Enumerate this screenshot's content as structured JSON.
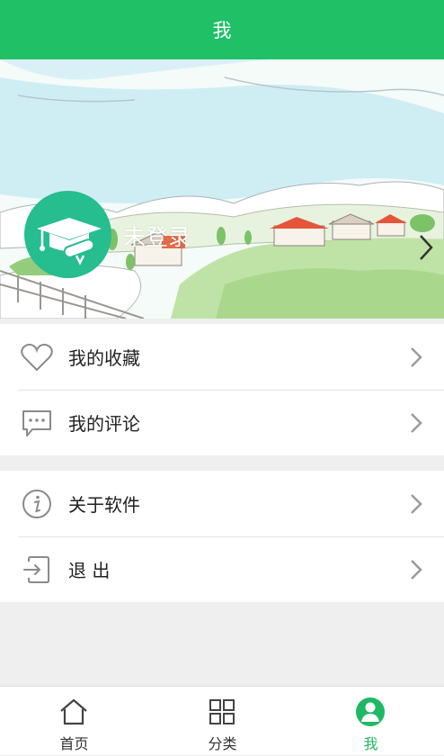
{
  "header": {
    "title": "我"
  },
  "profile": {
    "login_text": "未登录",
    "avatar_icon": "graduation-cap-icon"
  },
  "menu_group_1": [
    {
      "label": "我的收藏",
      "icon": "heart-icon"
    },
    {
      "label": "我的评论",
      "icon": "comment-icon"
    }
  ],
  "menu_group_2": [
    {
      "label": "关于软件",
      "icon": "info-icon"
    },
    {
      "label": "退 出",
      "icon": "logout-icon"
    }
  ],
  "tabs": [
    {
      "label": "首页",
      "icon": "home-icon"
    },
    {
      "label": "分类",
      "icon": "grid-icon"
    },
    {
      "label": "我",
      "icon": "user-icon",
      "active": true
    }
  ],
  "colors": {
    "accent": "#1fc066",
    "avatar_bg": "#26bd8f",
    "active_tab": "#1fb864"
  }
}
